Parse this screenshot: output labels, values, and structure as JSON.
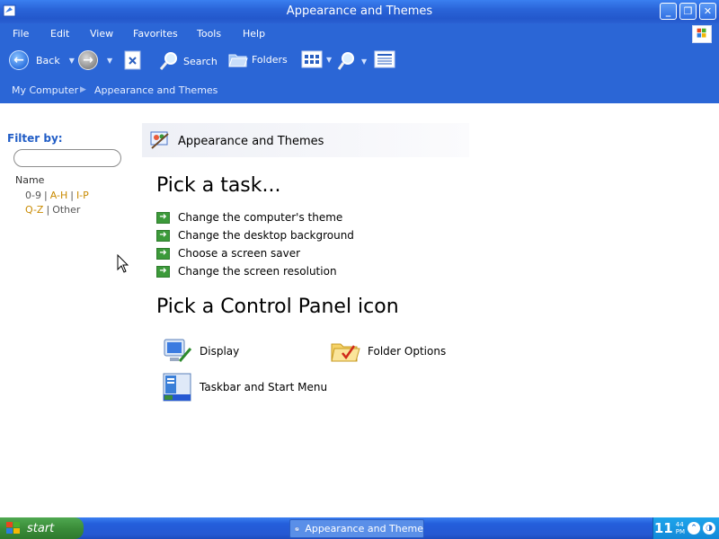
{
  "window": {
    "title": "Appearance and Themes"
  },
  "menu": {
    "items": [
      "File",
      "Edit",
      "View",
      "Favorites",
      "Tools",
      "Help"
    ]
  },
  "toolbar": {
    "back_label": "Back",
    "search_label": "Search",
    "folders_label": "Folders"
  },
  "address": {
    "crumb1": "My Computer",
    "crumb2": "Appearance and Themes"
  },
  "filter": {
    "label": "Filter by:",
    "search_placeholder": "",
    "name_label": "Name",
    "links_row1": [
      "0-9",
      "A-H",
      "I-P"
    ],
    "links_row2": [
      "Q-Z",
      "Other"
    ]
  },
  "content": {
    "header_title": "Appearance and Themes",
    "tasks_title": "Pick a task...",
    "tasks": [
      "Change the computer's theme",
      "Change the desktop background",
      "Choose a screen saver",
      "Change the screen resolution"
    ],
    "icons_title": "Pick a Control Panel icon",
    "icons": [
      {
        "label": "Display",
        "icon": "display-icon"
      },
      {
        "label": "Folder Options",
        "icon": "folder-options-icon"
      },
      {
        "label": "Taskbar and Start Menu",
        "icon": "taskbar-start-menu-icon"
      }
    ]
  },
  "taskbar": {
    "start_label": "start",
    "task_button_label": "Appearance and Theme",
    "clock_hour": "11",
    "clock_min": "44",
    "clock_ampm": "PM"
  },
  "colors": {
    "xp_blue": "#2b66d6",
    "link_orange": "#c98a00",
    "filter_blue": "#215dc6",
    "start_green": "#3b8d3a"
  }
}
